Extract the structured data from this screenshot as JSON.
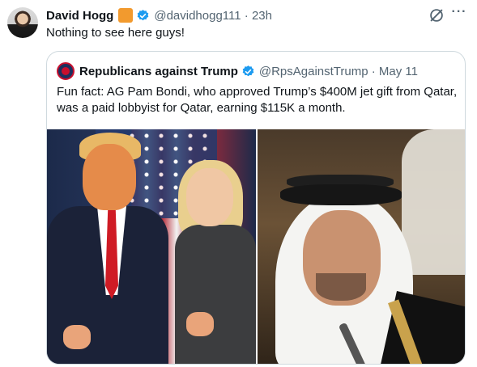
{
  "tweet": {
    "author_name": "David Hogg",
    "author_handle": "@davidhogg111",
    "time": "· 23h",
    "text": "Nothing to see here guys!",
    "more_label": "···"
  },
  "quote": {
    "author_name": "Republicans against Trump",
    "author_handle": "@RpsAgainstTrump",
    "time": "· May 11",
    "text": "Fun fact: AG Pam Bondi, who approved Trump’s $400M jet gift from Qatar, was a paid lobbyist for Qatar, earning $115K a month."
  },
  "colors": {
    "accent": "#1d9bf0",
    "org_badge": "#f29a2e",
    "secondary_text": "#536471",
    "border": "#cfd9de"
  },
  "icons": {
    "verified": "verified-badge-icon",
    "grok": "grok-icon",
    "more": "more-options-icon"
  }
}
